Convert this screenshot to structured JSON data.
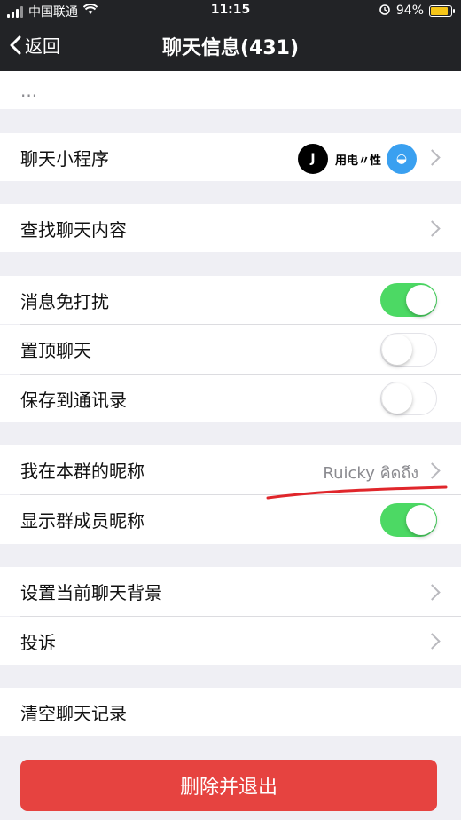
{
  "status_bar": {
    "carrier": "中国联通",
    "time": "11:15",
    "battery": "94%"
  },
  "nav": {
    "back_label": "返回",
    "title": "聊天信息(431)"
  },
  "partial_row": {
    "text": "..."
  },
  "mini_programs": {
    "label": "聊天小程序",
    "icons": [
      {
        "name": "mini-app-j-icon",
        "text": "J"
      },
      {
        "name": "mini-app-text-icon",
        "text": "用电〃性"
      },
      {
        "name": "mini-app-blue-icon",
        "text": "◒"
      }
    ]
  },
  "search": {
    "label": "查找聊天内容"
  },
  "settings": {
    "mute": {
      "label": "消息免打扰",
      "on": true
    },
    "pin": {
      "label": "置顶聊天",
      "on": false
    },
    "save_contacts": {
      "label": "保存到通讯录",
      "on": false
    }
  },
  "nickname": {
    "label": "我在本群的昵称",
    "value": "Ruicky คิดถึง"
  },
  "show_member_names": {
    "label": "显示群成员昵称",
    "on": true
  },
  "background": {
    "label": "设置当前聊天背景"
  },
  "complain": {
    "label": "投诉"
  },
  "clear_history": {
    "label": "清空聊天记录"
  },
  "delete_exit": {
    "label": "删除并退出"
  },
  "colors": {
    "accent_green": "#4cd964",
    "danger_red": "#e64340",
    "nav_bg": "#222326",
    "annotation_red": "#e0262b"
  }
}
